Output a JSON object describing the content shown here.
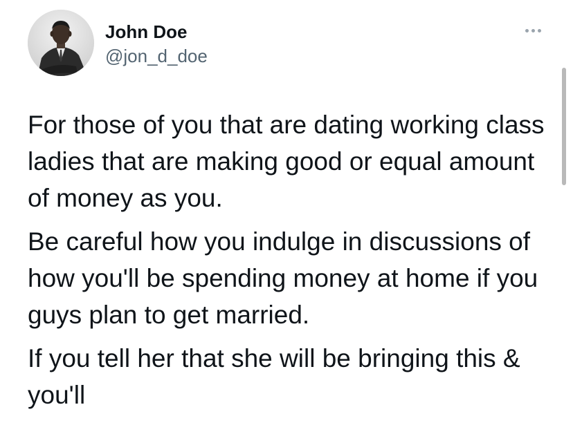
{
  "tweet": {
    "author": {
      "display_name": "John Doe",
      "handle": "@jon_d_doe",
      "avatar": "portrait-photo"
    },
    "more_icon": "more-horizontal-icon",
    "paragraphs": [
      "For those of you that are dating working class ladies that are making good or equal amount of money as you.",
      "Be careful how you indulge in discussions of how you'll be spending money at home if you guys plan to get married.",
      "If you tell her that she will be bringing this & you'll"
    ]
  },
  "colors": {
    "text": "#0f1419",
    "secondary_text": "#536471",
    "background": "#ffffff"
  }
}
